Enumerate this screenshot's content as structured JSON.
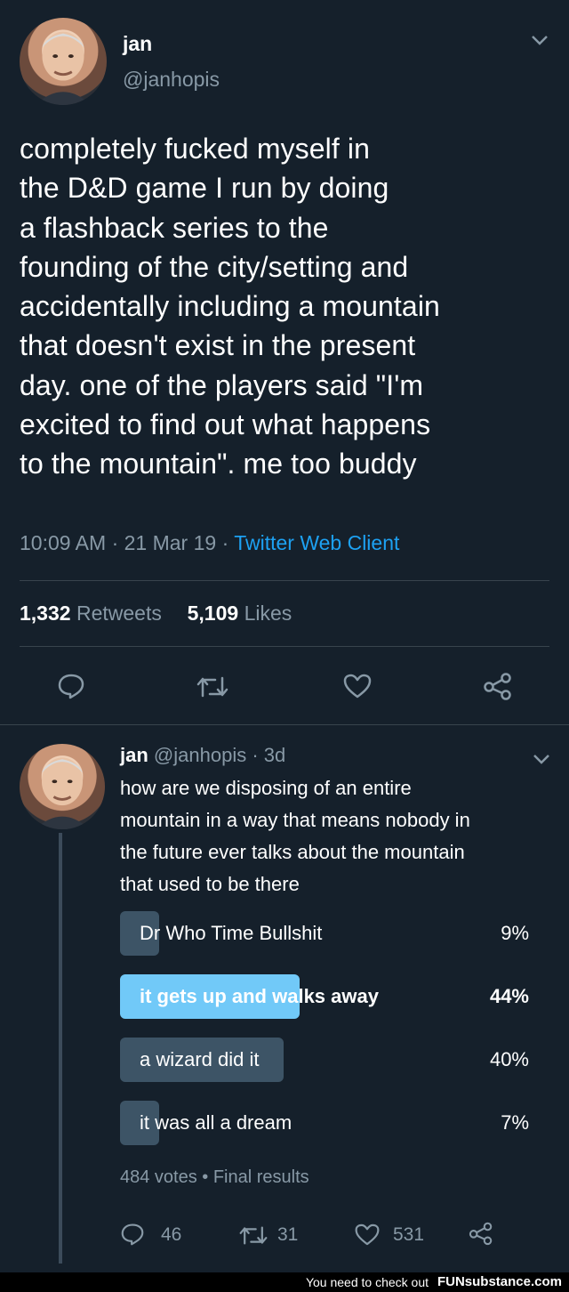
{
  "tweet": {
    "name": "jan",
    "handle": "@janhopis",
    "text_lines": [
      "completely fucked myself in",
      "the D&D game I run by doing",
      "a flashback series to the",
      "founding of the city/setting and",
      "accidentally including a mountain",
      "that doesn't exist in the present",
      "day. one of the players said \"I'm",
      "excited to find out what happens",
      "to the mountain\". me too buddy"
    ],
    "timestamp": "10:09 AM · 21 Mar 19 · ",
    "client": "Twitter Web Client",
    "retweets_count": "1,332",
    "retweets_label": "Retweets",
    "likes_count": "5,109",
    "likes_label": "Likes"
  },
  "reply": {
    "name": "jan",
    "handle_age": "@janhopis · 3d",
    "text_lines": [
      "how are we disposing of an entire",
      "mountain in a way that means nobody in",
      "the future ever talks about the mountain",
      "that used to be there"
    ],
    "poll": [
      {
        "label": "Dr Who Time Bullshit",
        "percent": "9%",
        "fraction": 0.09,
        "winner": false
      },
      {
        "label": "it gets up and walks away",
        "percent": "44%",
        "fraction": 0.44,
        "winner": true
      },
      {
        "label": "a wizard did it",
        "percent": "40%",
        "fraction": 0.4,
        "winner": false
      },
      {
        "label": "it was all a dream",
        "percent": "7%",
        "fraction": 0.07,
        "winner": false
      }
    ],
    "poll_footer": "484 votes • Final results",
    "reply_count": "46",
    "retweet_count": "31",
    "like_count": "531"
  },
  "watermark": {
    "text": "You need to check out",
    "brand": "FUNsubstance.com"
  },
  "colors": {
    "background": "#15202b",
    "muted": "#8899a6",
    "accent": "#1da1f2",
    "poll_winner": "#71c9f8",
    "poll_other": "#3d5466"
  }
}
